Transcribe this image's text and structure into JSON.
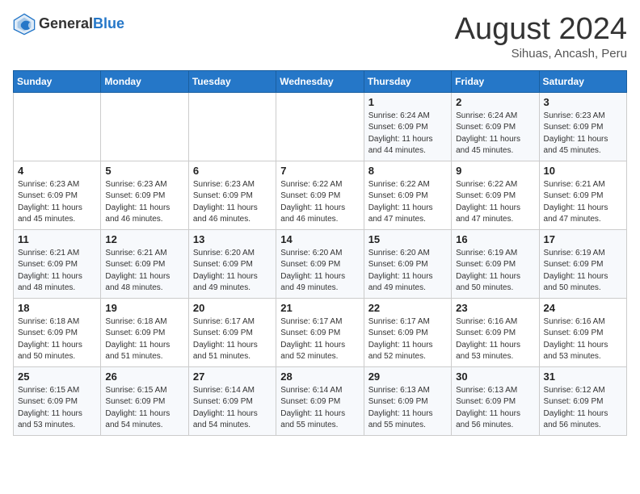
{
  "header": {
    "logo_general": "General",
    "logo_blue": "Blue",
    "month": "August 2024",
    "location": "Sihuas, Ancash, Peru"
  },
  "weekdays": [
    "Sunday",
    "Monday",
    "Tuesday",
    "Wednesday",
    "Thursday",
    "Friday",
    "Saturday"
  ],
  "weeks": [
    [
      {
        "day": "",
        "info": ""
      },
      {
        "day": "",
        "info": ""
      },
      {
        "day": "",
        "info": ""
      },
      {
        "day": "",
        "info": ""
      },
      {
        "day": "1",
        "info": "Sunrise: 6:24 AM\nSunset: 6:09 PM\nDaylight: 11 hours\nand 44 minutes."
      },
      {
        "day": "2",
        "info": "Sunrise: 6:24 AM\nSunset: 6:09 PM\nDaylight: 11 hours\nand 45 minutes."
      },
      {
        "day": "3",
        "info": "Sunrise: 6:23 AM\nSunset: 6:09 PM\nDaylight: 11 hours\nand 45 minutes."
      }
    ],
    [
      {
        "day": "4",
        "info": "Sunrise: 6:23 AM\nSunset: 6:09 PM\nDaylight: 11 hours\nand 45 minutes."
      },
      {
        "day": "5",
        "info": "Sunrise: 6:23 AM\nSunset: 6:09 PM\nDaylight: 11 hours\nand 46 minutes."
      },
      {
        "day": "6",
        "info": "Sunrise: 6:23 AM\nSunset: 6:09 PM\nDaylight: 11 hours\nand 46 minutes."
      },
      {
        "day": "7",
        "info": "Sunrise: 6:22 AM\nSunset: 6:09 PM\nDaylight: 11 hours\nand 46 minutes."
      },
      {
        "day": "8",
        "info": "Sunrise: 6:22 AM\nSunset: 6:09 PM\nDaylight: 11 hours\nand 47 minutes."
      },
      {
        "day": "9",
        "info": "Sunrise: 6:22 AM\nSunset: 6:09 PM\nDaylight: 11 hours\nand 47 minutes."
      },
      {
        "day": "10",
        "info": "Sunrise: 6:21 AM\nSunset: 6:09 PM\nDaylight: 11 hours\nand 47 minutes."
      }
    ],
    [
      {
        "day": "11",
        "info": "Sunrise: 6:21 AM\nSunset: 6:09 PM\nDaylight: 11 hours\nand 48 minutes."
      },
      {
        "day": "12",
        "info": "Sunrise: 6:21 AM\nSunset: 6:09 PM\nDaylight: 11 hours\nand 48 minutes."
      },
      {
        "day": "13",
        "info": "Sunrise: 6:20 AM\nSunset: 6:09 PM\nDaylight: 11 hours\nand 49 minutes."
      },
      {
        "day": "14",
        "info": "Sunrise: 6:20 AM\nSunset: 6:09 PM\nDaylight: 11 hours\nand 49 minutes."
      },
      {
        "day": "15",
        "info": "Sunrise: 6:20 AM\nSunset: 6:09 PM\nDaylight: 11 hours\nand 49 minutes."
      },
      {
        "day": "16",
        "info": "Sunrise: 6:19 AM\nSunset: 6:09 PM\nDaylight: 11 hours\nand 50 minutes."
      },
      {
        "day": "17",
        "info": "Sunrise: 6:19 AM\nSunset: 6:09 PM\nDaylight: 11 hours\nand 50 minutes."
      }
    ],
    [
      {
        "day": "18",
        "info": "Sunrise: 6:18 AM\nSunset: 6:09 PM\nDaylight: 11 hours\nand 50 minutes."
      },
      {
        "day": "19",
        "info": "Sunrise: 6:18 AM\nSunset: 6:09 PM\nDaylight: 11 hours\nand 51 minutes."
      },
      {
        "day": "20",
        "info": "Sunrise: 6:17 AM\nSunset: 6:09 PM\nDaylight: 11 hours\nand 51 minutes."
      },
      {
        "day": "21",
        "info": "Sunrise: 6:17 AM\nSunset: 6:09 PM\nDaylight: 11 hours\nand 52 minutes."
      },
      {
        "day": "22",
        "info": "Sunrise: 6:17 AM\nSunset: 6:09 PM\nDaylight: 11 hours\nand 52 minutes."
      },
      {
        "day": "23",
        "info": "Sunrise: 6:16 AM\nSunset: 6:09 PM\nDaylight: 11 hours\nand 53 minutes."
      },
      {
        "day": "24",
        "info": "Sunrise: 6:16 AM\nSunset: 6:09 PM\nDaylight: 11 hours\nand 53 minutes."
      }
    ],
    [
      {
        "day": "25",
        "info": "Sunrise: 6:15 AM\nSunset: 6:09 PM\nDaylight: 11 hours\nand 53 minutes."
      },
      {
        "day": "26",
        "info": "Sunrise: 6:15 AM\nSunset: 6:09 PM\nDaylight: 11 hours\nand 54 minutes."
      },
      {
        "day": "27",
        "info": "Sunrise: 6:14 AM\nSunset: 6:09 PM\nDaylight: 11 hours\nand 54 minutes."
      },
      {
        "day": "28",
        "info": "Sunrise: 6:14 AM\nSunset: 6:09 PM\nDaylight: 11 hours\nand 55 minutes."
      },
      {
        "day": "29",
        "info": "Sunrise: 6:13 AM\nSunset: 6:09 PM\nDaylight: 11 hours\nand 55 minutes."
      },
      {
        "day": "30",
        "info": "Sunrise: 6:13 AM\nSunset: 6:09 PM\nDaylight: 11 hours\nand 56 minutes."
      },
      {
        "day": "31",
        "info": "Sunrise: 6:12 AM\nSunset: 6:09 PM\nDaylight: 11 hours\nand 56 minutes."
      }
    ]
  ]
}
